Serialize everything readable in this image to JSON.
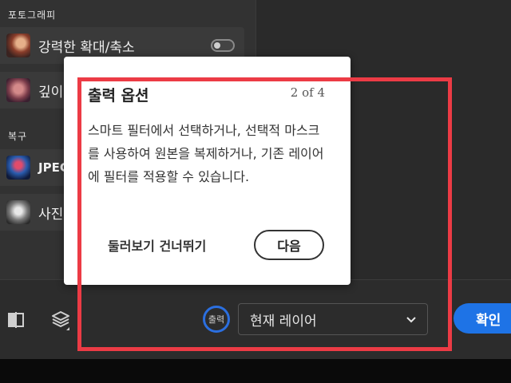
{
  "left_panel": {
    "section_photography": "포토그래피",
    "section_restore": "복구",
    "filters": [
      {
        "label": "강력한 확대/축소",
        "toggle_on": false
      },
      {
        "label": "깊이"
      },
      {
        "label": "JPEG"
      },
      {
        "label": "사진"
      }
    ]
  },
  "toolbar": {
    "output_label": "출력",
    "output_select_value": "현재 레이어",
    "confirm_label": "확인"
  },
  "tour": {
    "title": "출력 옵션",
    "step": "2 of 4",
    "body": "스마트 필터에서 선택하거나, 선택적 마스크를 사용하여 원본을 복제하거나, 기존 레이어에 필터를 적용할 수 있습니다.",
    "skip_label": "둘러보기 건너뛰기",
    "next_label": "다음"
  },
  "colors": {
    "accent": "#1e73e6",
    "highlight": "#ec3b45"
  }
}
